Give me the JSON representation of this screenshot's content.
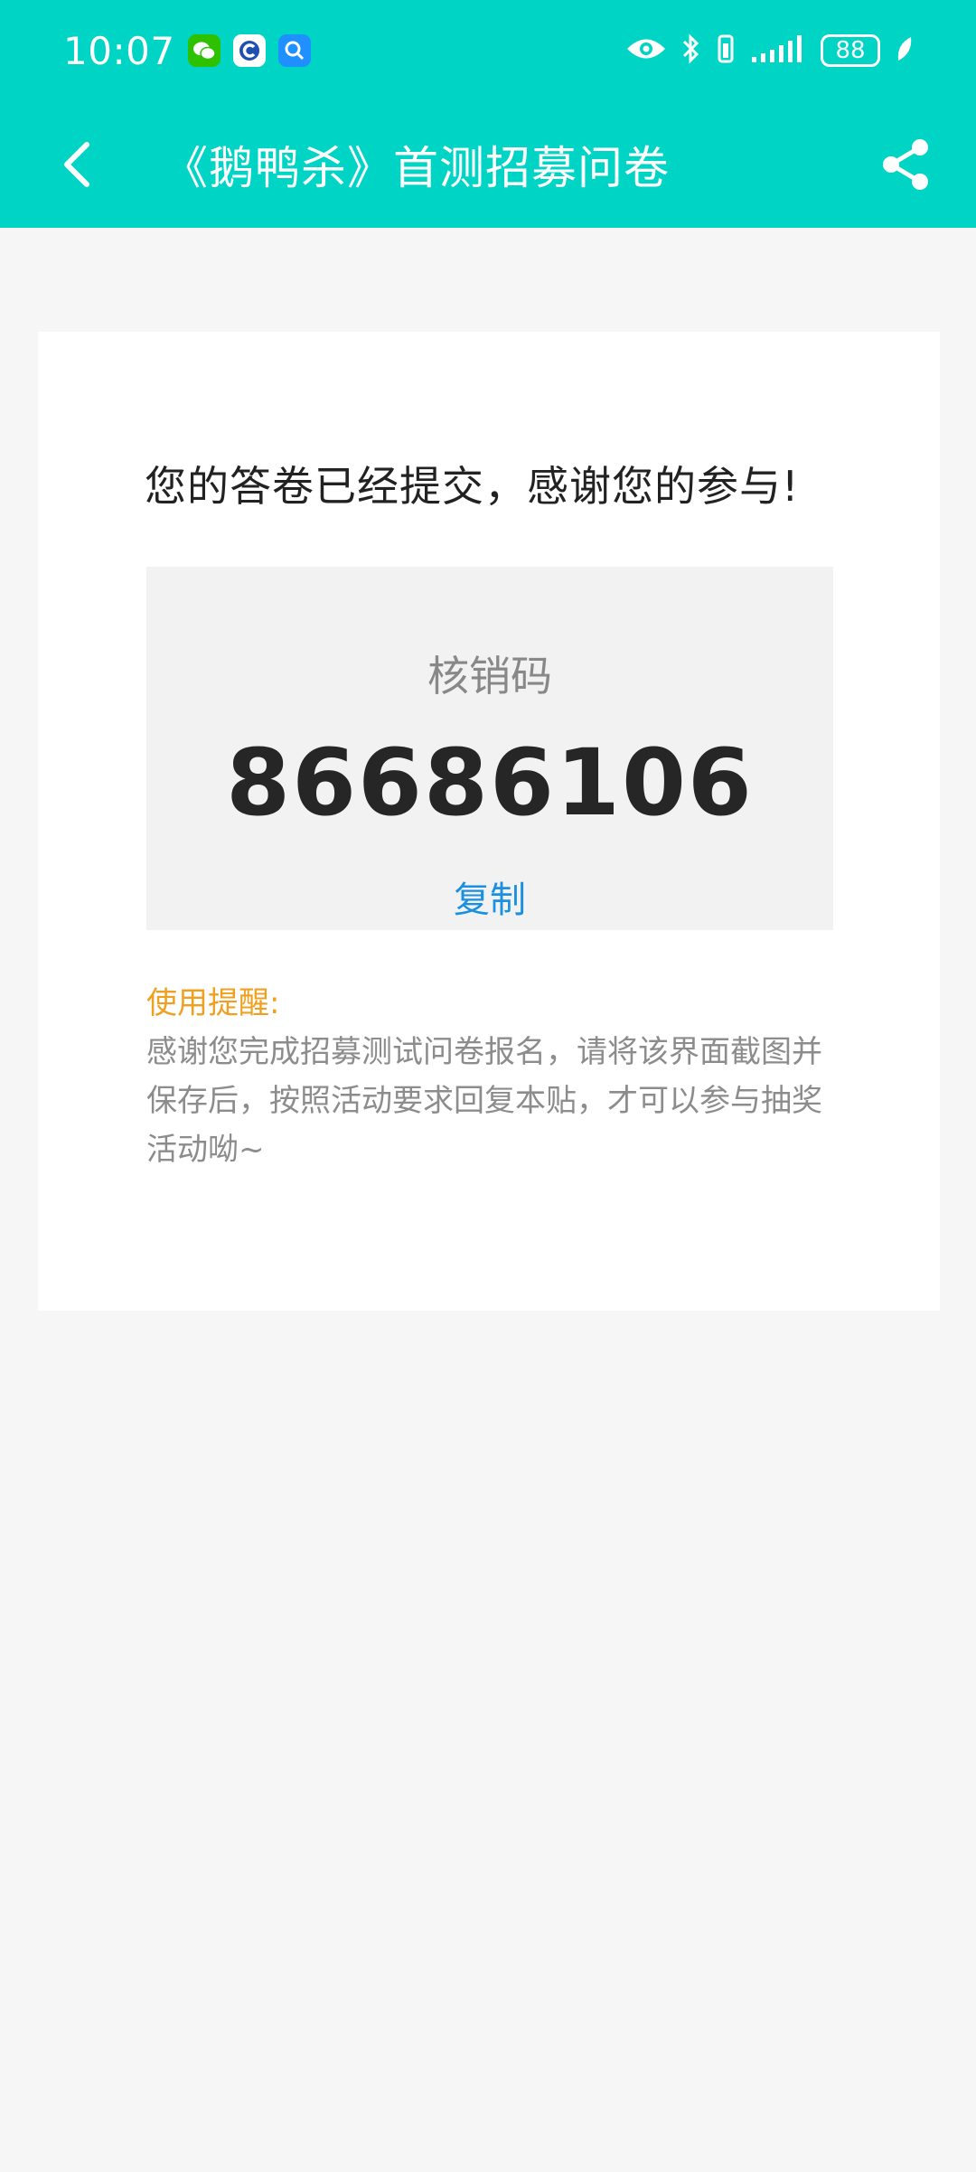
{
  "status_bar": {
    "time": "10:07",
    "battery": "88",
    "notification_icons": [
      "wechat-icon",
      "browser-icon",
      "search-app-icon"
    ],
    "system_icons": [
      "eye-icon",
      "bluetooth-icon",
      "vibrate-icon",
      "signal-icon",
      "battery-icon",
      "leaf-icon"
    ]
  },
  "header": {
    "title": "《鹅鸭杀》首测招募问卷",
    "back_icon": "chevron-left-icon",
    "share_icon": "share-icon"
  },
  "content": {
    "headline": "您的答卷已经提交，感谢您的参与!",
    "code_label": "核销码",
    "code_value": "86686106",
    "copy_label": "复制",
    "tip_title": "使用提醒:",
    "tip_text": "感谢您完成招募测试问卷报名，请将该界面截图并保存后，按照活动要求回复本贴，才可以参与抽奖活动呦~"
  },
  "colors": {
    "header_bg": "#00d4c5",
    "page_bg": "#f6f6f6",
    "accent_blue": "#1b8fe0",
    "tip_orange": "#f0a020"
  }
}
